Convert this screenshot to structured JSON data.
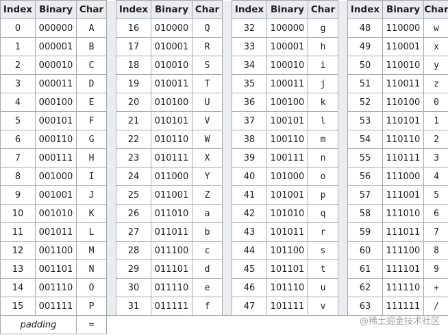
{
  "headers": [
    "Index",
    "Binary",
    "Char"
  ],
  "entries": [
    {
      "index": "0",
      "binary": "000000",
      "char": "A"
    },
    {
      "index": "1",
      "binary": "000001",
      "char": "B"
    },
    {
      "index": "2",
      "binary": "000010",
      "char": "C"
    },
    {
      "index": "3",
      "binary": "000011",
      "char": "D"
    },
    {
      "index": "4",
      "binary": "000100",
      "char": "E"
    },
    {
      "index": "5",
      "binary": "000101",
      "char": "F"
    },
    {
      "index": "6",
      "binary": "000110",
      "char": "G"
    },
    {
      "index": "7",
      "binary": "000111",
      "char": "H"
    },
    {
      "index": "8",
      "binary": "001000",
      "char": "I"
    },
    {
      "index": "9",
      "binary": "001001",
      "char": "J"
    },
    {
      "index": "10",
      "binary": "001010",
      "char": "K"
    },
    {
      "index": "11",
      "binary": "001011",
      "char": "L"
    },
    {
      "index": "12",
      "binary": "001100",
      "char": "M"
    },
    {
      "index": "13",
      "binary": "001101",
      "char": "N"
    },
    {
      "index": "14",
      "binary": "001110",
      "char": "O"
    },
    {
      "index": "15",
      "binary": "001111",
      "char": "P"
    },
    {
      "index": "16",
      "binary": "010000",
      "char": "Q"
    },
    {
      "index": "17",
      "binary": "010001",
      "char": "R"
    },
    {
      "index": "18",
      "binary": "010010",
      "char": "S"
    },
    {
      "index": "19",
      "binary": "010011",
      "char": "T"
    },
    {
      "index": "20",
      "binary": "010100",
      "char": "U"
    },
    {
      "index": "21",
      "binary": "010101",
      "char": "V"
    },
    {
      "index": "22",
      "binary": "010110",
      "char": "W"
    },
    {
      "index": "23",
      "binary": "010111",
      "char": "X"
    },
    {
      "index": "24",
      "binary": "011000",
      "char": "Y"
    },
    {
      "index": "25",
      "binary": "011001",
      "char": "Z"
    },
    {
      "index": "26",
      "binary": "011010",
      "char": "a"
    },
    {
      "index": "27",
      "binary": "011011",
      "char": "b"
    },
    {
      "index": "28",
      "binary": "011100",
      "char": "c"
    },
    {
      "index": "29",
      "binary": "011101",
      "char": "d"
    },
    {
      "index": "30",
      "binary": "011110",
      "char": "e"
    },
    {
      "index": "31",
      "binary": "011111",
      "char": "f"
    },
    {
      "index": "32",
      "binary": "100000",
      "char": "g"
    },
    {
      "index": "33",
      "binary": "100001",
      "char": "h"
    },
    {
      "index": "34",
      "binary": "100010",
      "char": "i"
    },
    {
      "index": "35",
      "binary": "100011",
      "char": "j"
    },
    {
      "index": "36",
      "binary": "100100",
      "char": "k"
    },
    {
      "index": "37",
      "binary": "100101",
      "char": "l"
    },
    {
      "index": "38",
      "binary": "100110",
      "char": "m"
    },
    {
      "index": "39",
      "binary": "100111",
      "char": "n"
    },
    {
      "index": "40",
      "binary": "101000",
      "char": "o"
    },
    {
      "index": "41",
      "binary": "101001",
      "char": "p"
    },
    {
      "index": "42",
      "binary": "101010",
      "char": "q"
    },
    {
      "index": "43",
      "binary": "101011",
      "char": "r"
    },
    {
      "index": "44",
      "binary": "101100",
      "char": "s"
    },
    {
      "index": "45",
      "binary": "101101",
      "char": "t"
    },
    {
      "index": "46",
      "binary": "101110",
      "char": "u"
    },
    {
      "index": "47",
      "binary": "101111",
      "char": "v"
    },
    {
      "index": "48",
      "binary": "110000",
      "char": "w"
    },
    {
      "index": "49",
      "binary": "110001",
      "char": "x"
    },
    {
      "index": "50",
      "binary": "110010",
      "char": "y"
    },
    {
      "index": "51",
      "binary": "110011",
      "char": "z"
    },
    {
      "index": "52",
      "binary": "110100",
      "char": "0"
    },
    {
      "index": "53",
      "binary": "110101",
      "char": "1"
    },
    {
      "index": "54",
      "binary": "110110",
      "char": "2"
    },
    {
      "index": "55",
      "binary": "110111",
      "char": "3"
    },
    {
      "index": "56",
      "binary": "111000",
      "char": "4"
    },
    {
      "index": "57",
      "binary": "111001",
      "char": "5"
    },
    {
      "index": "58",
      "binary": "111010",
      "char": "6"
    },
    {
      "index": "59",
      "binary": "111011",
      "char": "7"
    },
    {
      "index": "60",
      "binary": "111100",
      "char": "8"
    },
    {
      "index": "61",
      "binary": "111101",
      "char": "9"
    },
    {
      "index": "62",
      "binary": "111110",
      "char": "+"
    },
    {
      "index": "63",
      "binary": "111111",
      "char": "/"
    }
  ],
  "padding": {
    "label": "padding",
    "char": "="
  },
  "watermark": "@稀土掘金技术社区"
}
